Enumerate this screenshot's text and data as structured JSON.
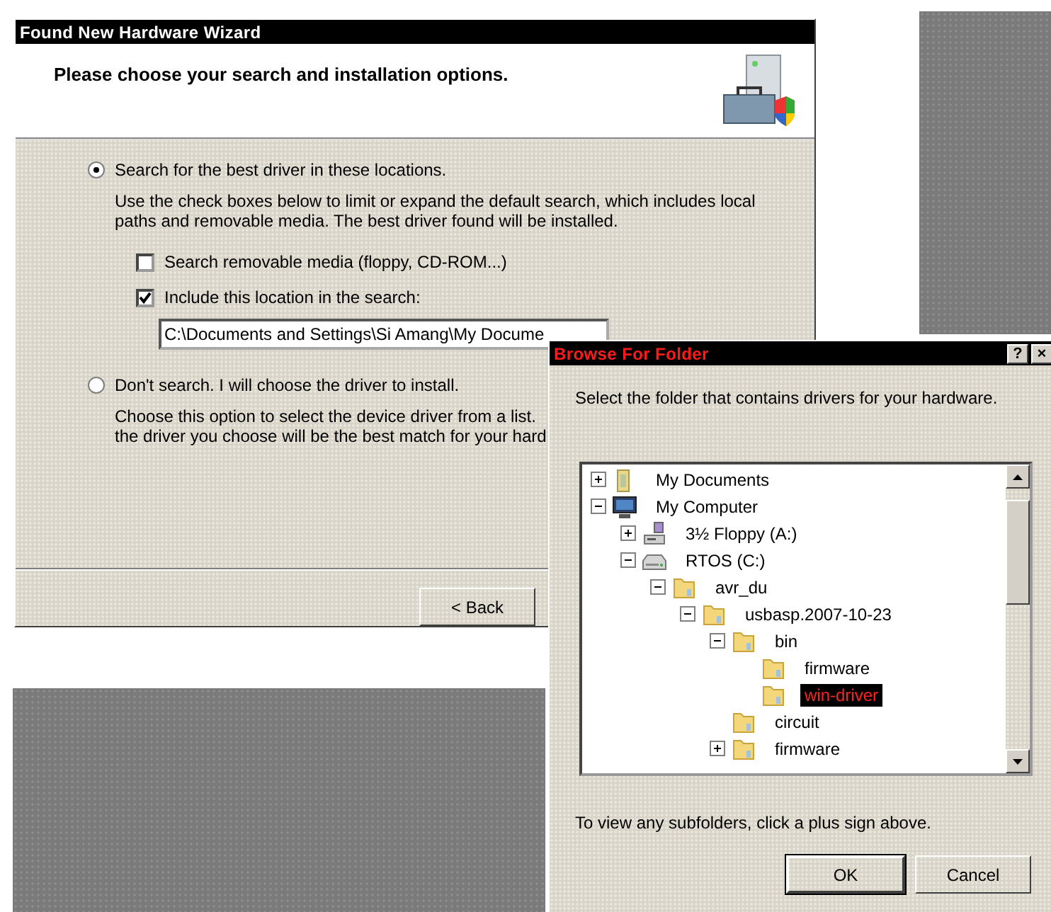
{
  "wizard": {
    "title": "Found New Hardware Wizard",
    "heading": "Please choose your search and installation options.",
    "options": [
      {
        "label": "Search for the best driver in these locations.",
        "selected": true,
        "description": [
          "Use the check boxes below to limit or expand the default search, which includes local",
          "paths and removable media. The best driver found will be installed."
        ]
      },
      {
        "label": "Don't search. I will choose the driver to install.",
        "selected": false,
        "description": [
          "Choose this option to select the device driver from a list.",
          "the driver you choose will be the best match for your hard"
        ]
      }
    ],
    "checkboxes": [
      {
        "label": "Search removable media (floppy, CD-ROM...)",
        "checked": false
      },
      {
        "label": "Include this location in the search:",
        "checked": true
      }
    ],
    "path_value": "C:\\Documents and Settings\\Si Amang\\My Docume",
    "buttons": [
      "< Back"
    ]
  },
  "browse": {
    "title": "Browse For Folder",
    "title_buttons": [
      "?",
      "×"
    ],
    "instruction": "Select the folder that contains drivers for your hardware.",
    "tree": [
      {
        "label": "My Documents",
        "kind": "documents",
        "expanded": false,
        "selected": false
      },
      {
        "label": "My Computer",
        "kind": "computer",
        "expanded": true,
        "selected": false,
        "children": [
          {
            "label": "3½ Floppy (A:)",
            "kind": "floppy",
            "expanded": false,
            "selected": false
          },
          {
            "label": "RTOS (C:)",
            "kind": "drive",
            "expanded": true,
            "selected": false,
            "children": [
              {
                "label": "avr_du",
                "kind": "folder",
                "expanded": true,
                "selected": false,
                "children": [
                  {
                    "label": "usbasp.2007-10-23",
                    "kind": "folder",
                    "expanded": true,
                    "selected": false,
                    "children": [
                      {
                        "label": "bin",
                        "kind": "folder",
                        "expanded": true,
                        "selected": false,
                        "children": [
                          {
                            "label": "firmware",
                            "kind": "folder",
                            "selected": false
                          },
                          {
                            "label": "win-driver",
                            "kind": "folder",
                            "selected": true
                          }
                        ]
                      },
                      {
                        "label": "circuit",
                        "kind": "folder",
                        "selected": false
                      },
                      {
                        "label": "firmware",
                        "kind": "folder",
                        "expanded": false,
                        "selected": false
                      }
                    ]
                  }
                ]
              }
            ]
          }
        ]
      }
    ],
    "hint": "To view any subfolders, click a plus sign above.",
    "buttons": [
      "OK",
      "Cancel"
    ]
  }
}
